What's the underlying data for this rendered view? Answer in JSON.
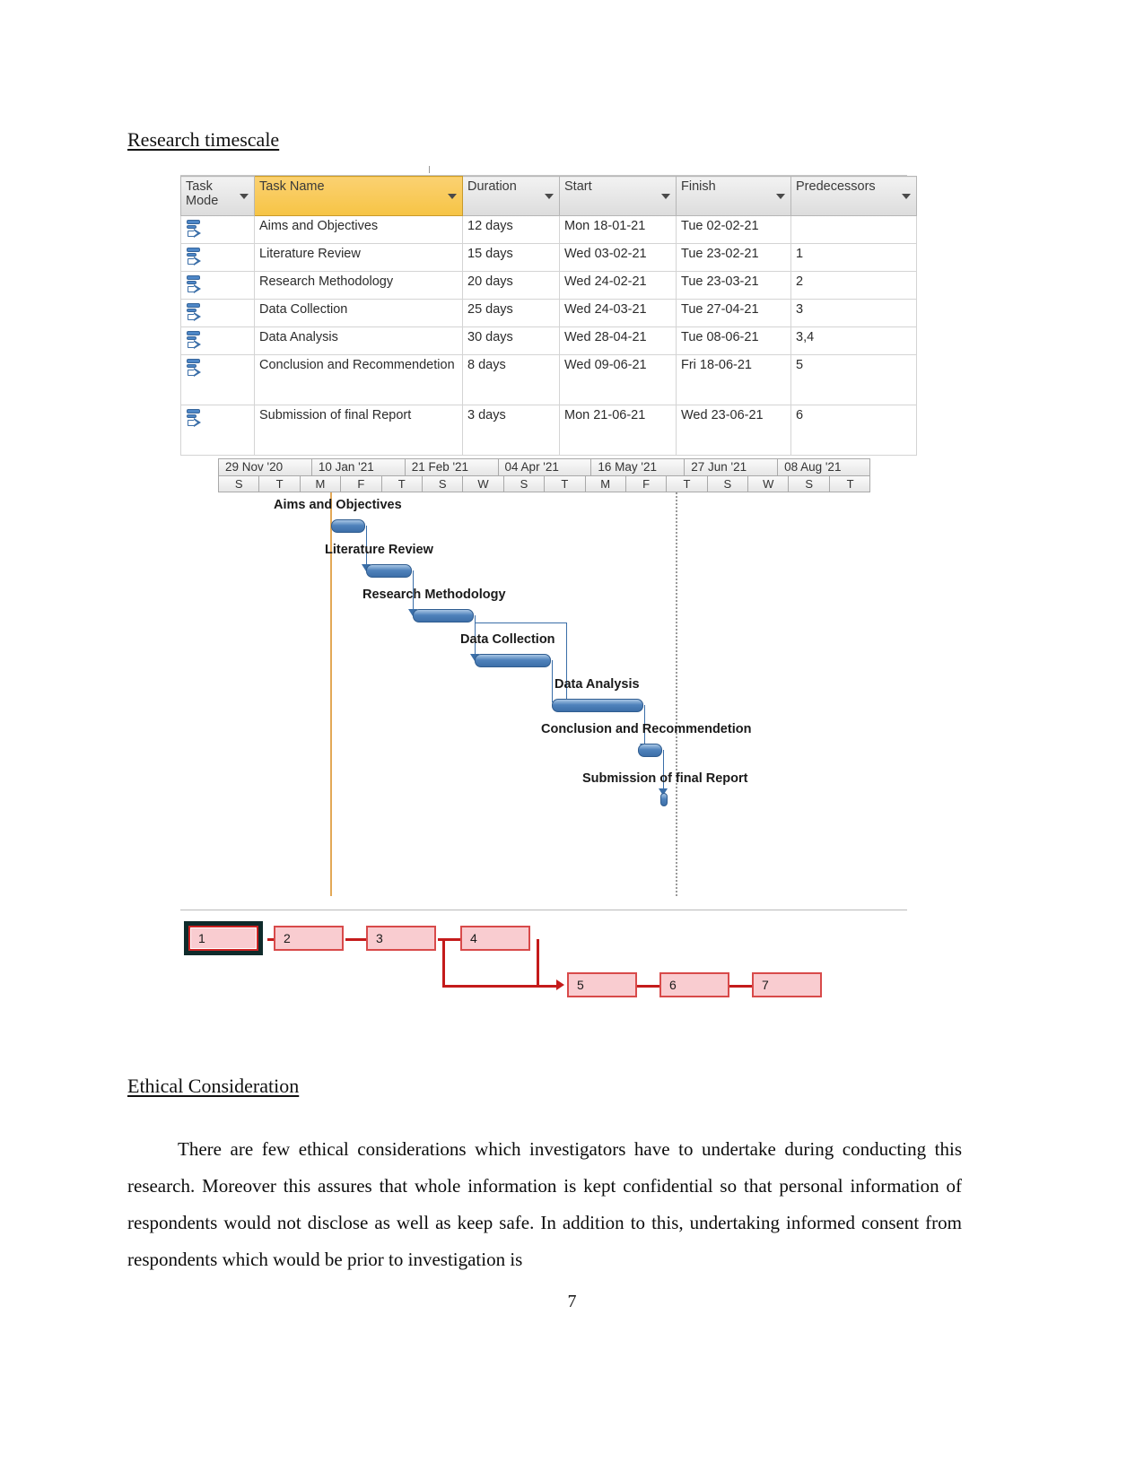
{
  "headings": {
    "research_timescale": "Research timescale",
    "ethical_consideration": "Ethical Consideration"
  },
  "project_table": {
    "columns": [
      {
        "label": "Task Mode",
        "key": "mode"
      },
      {
        "label": "Task Name",
        "key": "name"
      },
      {
        "label": "Duration",
        "key": "duration"
      },
      {
        "label": "Start",
        "key": "start"
      },
      {
        "label": "Finish",
        "key": "finish"
      },
      {
        "label": "Predecessors",
        "key": "predecessors"
      }
    ],
    "header_highlight_color": "#f6c445",
    "rows": [
      {
        "id": 1,
        "mode_icon": "auto-schedule-icon",
        "name": "Aims and Objectives",
        "duration": "12 days",
        "start": "Mon 18-01-21",
        "finish": "Tue 02-02-21",
        "predecessors": ""
      },
      {
        "id": 2,
        "mode_icon": "auto-schedule-icon",
        "name": "Literature Review",
        "duration": "15 days",
        "start": "Wed 03-02-21",
        "finish": "Tue 23-02-21",
        "predecessors": "1"
      },
      {
        "id": 3,
        "mode_icon": "auto-schedule-icon",
        "name": "Research Methodology",
        "duration": "20 days",
        "start": "Wed 24-02-21",
        "finish": "Tue 23-03-21",
        "predecessors": "2"
      },
      {
        "id": 4,
        "mode_icon": "auto-schedule-icon",
        "name": "Data Collection",
        "duration": "25 days",
        "start": "Wed 24-03-21",
        "finish": "Tue 27-04-21",
        "predecessors": "3"
      },
      {
        "id": 5,
        "mode_icon": "auto-schedule-icon",
        "name": "Data Analysis",
        "duration": "30 days",
        "start": "Wed 28-04-21",
        "finish": "Tue 08-06-21",
        "predecessors": "3,4"
      },
      {
        "id": 6,
        "mode_icon": "auto-schedule-icon",
        "name": "Conclusion and Recommendetion",
        "duration": "8 days",
        "start": "Wed 09-06-21",
        "finish": "Fri 18-06-21",
        "predecessors": "5"
      },
      {
        "id": 7,
        "mode_icon": "auto-schedule-icon",
        "name": "Submission of final Report",
        "duration": "3 days",
        "start": "Mon 21-06-21",
        "finish": "Wed 23-06-21",
        "predecessors": "6"
      }
    ]
  },
  "chart_data": {
    "type": "bar",
    "subtype": "gantt",
    "title": "Research timescale",
    "xlabel": "",
    "ylabel": "",
    "timescale_major": [
      "29 Nov '20",
      "10 Jan '21",
      "21 Feb '21",
      "04 Apr '21",
      "16 May '21",
      "27 Jun '21",
      "08 Aug '21"
    ],
    "timescale_minor": [
      "S",
      "T",
      "M",
      "F",
      "T",
      "S",
      "W",
      "S",
      "T",
      "M",
      "F",
      "T",
      "S",
      "W",
      "S",
      "T"
    ],
    "axis_start": "2020-11-29",
    "axis_end": "2021-08-21",
    "tasks": [
      {
        "id": 1,
        "name": "Aims and Objectives",
        "start": "2021-01-18",
        "finish": "2021-02-02",
        "duration_days": 12,
        "predecessors": []
      },
      {
        "id": 2,
        "name": "Literature Review",
        "start": "2021-02-03",
        "finish": "2021-02-23",
        "duration_days": 15,
        "predecessors": [
          1
        ]
      },
      {
        "id": 3,
        "name": "Research Methodology",
        "start": "2021-02-24",
        "finish": "2021-03-23",
        "duration_days": 20,
        "predecessors": [
          2
        ]
      },
      {
        "id": 4,
        "name": "Data Collection",
        "start": "2021-03-24",
        "finish": "2021-04-27",
        "duration_days": 25,
        "predecessors": [
          3
        ]
      },
      {
        "id": 5,
        "name": "Data Analysis",
        "start": "2021-04-28",
        "finish": "2021-06-08",
        "duration_days": 30,
        "predecessors": [
          3,
          4
        ]
      },
      {
        "id": 6,
        "name": "Conclusion and Recommendetion",
        "start": "2021-06-09",
        "finish": "2021-06-18",
        "duration_days": 8,
        "predecessors": [
          5
        ]
      },
      {
        "id": 7,
        "name": "Submission of final Report",
        "start": "2021-06-21",
        "finish": "2021-06-23",
        "duration_days": 3,
        "predecessors": [
          6
        ]
      }
    ],
    "bar_color": "#4f82bb",
    "grid": false,
    "legend": "none"
  },
  "network_diagram": {
    "nodes": [
      "1",
      "2",
      "3",
      "4",
      "5",
      "6",
      "7"
    ],
    "node_fill": "#f9ccd0",
    "node_border": "#d84a4a",
    "link_color": "#c41b1b",
    "edges": [
      [
        "1",
        "2"
      ],
      [
        "2",
        "3"
      ],
      [
        "3",
        "4"
      ],
      [
        "3",
        "5"
      ],
      [
        "4",
        "5"
      ],
      [
        "5",
        "6"
      ],
      [
        "6",
        "7"
      ]
    ]
  },
  "body": {
    "ethical_paragraph": "There are few ethical considerations which investigators have to undertake during conducting this research. Moreover this assures that whole information is kept confidential so that personal information of respondents would not disclose as well as keep safe. In addition to this, undertaking informed consent from respondents which would be prior to investigation is"
  },
  "footer": {
    "page_number": "7"
  }
}
